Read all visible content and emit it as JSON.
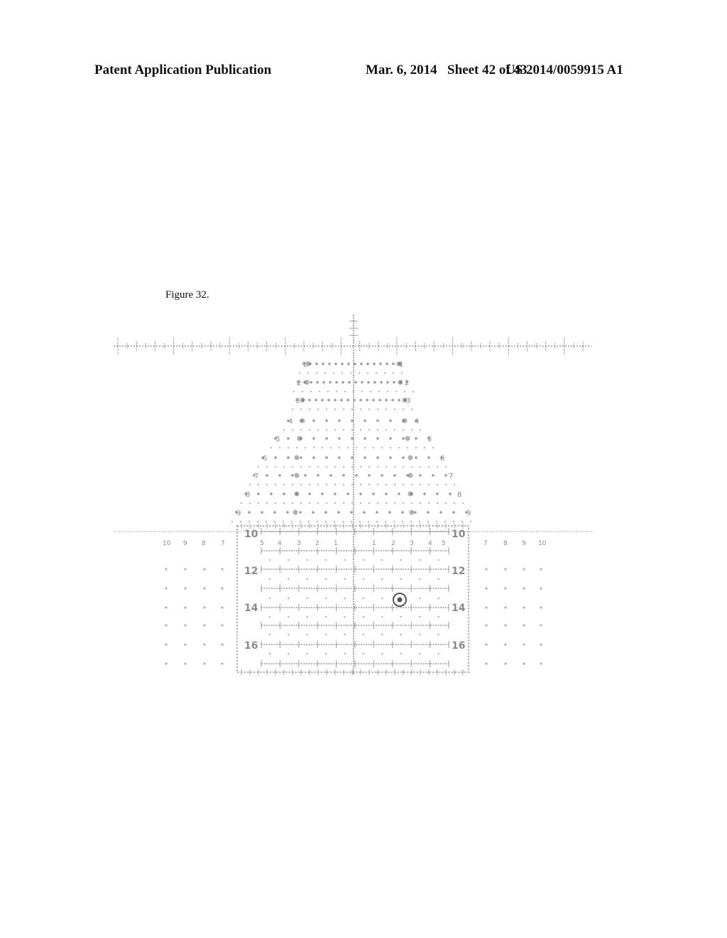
{
  "header": {
    "publication_type": "Patent Application Publication",
    "date": "Mar. 6, 2014",
    "sheet": "Sheet 42 of 43",
    "patent_number": "US 2014/0059915 A1"
  },
  "figure": {
    "label": "Figure 32.",
    "description": "Reticle with horizontal stadia, vertical center post, triangular holdover grid and boxed lower grid with aim-point marker",
    "colors": {
      "ink": "#9a9a9a",
      "dark_ink": "#6f6f6f",
      "background": "#ffffff"
    },
    "tree_rows": [
      {
        "label_left": "1",
        "label_right": "1"
      },
      {
        "label_left": "2",
        "label_right": "2"
      },
      {
        "label_left": "3",
        "label_right": "3"
      },
      {
        "label_left": "4",
        "label_right": "4"
      },
      {
        "label_left": "5",
        "label_right": "5"
      },
      {
        "label_left": "6",
        "label_right": "6"
      },
      {
        "label_left": "7",
        "label_right": "7"
      },
      {
        "label_left": "8",
        "label_right": "8"
      },
      {
        "label_left": "9",
        "label_right": "9"
      }
    ],
    "box_labels": [
      {
        "row": "10",
        "left": "10",
        "right": "10"
      },
      {
        "row": "12",
        "left": "12",
        "right": "12"
      },
      {
        "row": "14",
        "left": "14",
        "right": "14"
      },
      {
        "row": "16",
        "left": "16",
        "right": "16"
      }
    ],
    "box_scale_left": [
      "5",
      "4",
      "3",
      "2",
      "1"
    ],
    "box_scale_right": [
      "1",
      "2",
      "3",
      "4",
      "5"
    ],
    "outer_scale_left": [
      "10",
      "9",
      "8",
      "7"
    ],
    "outer_scale_right": [
      "7",
      "8",
      "9",
      "10"
    ],
    "aim_marker": "bullseye-circle"
  }
}
